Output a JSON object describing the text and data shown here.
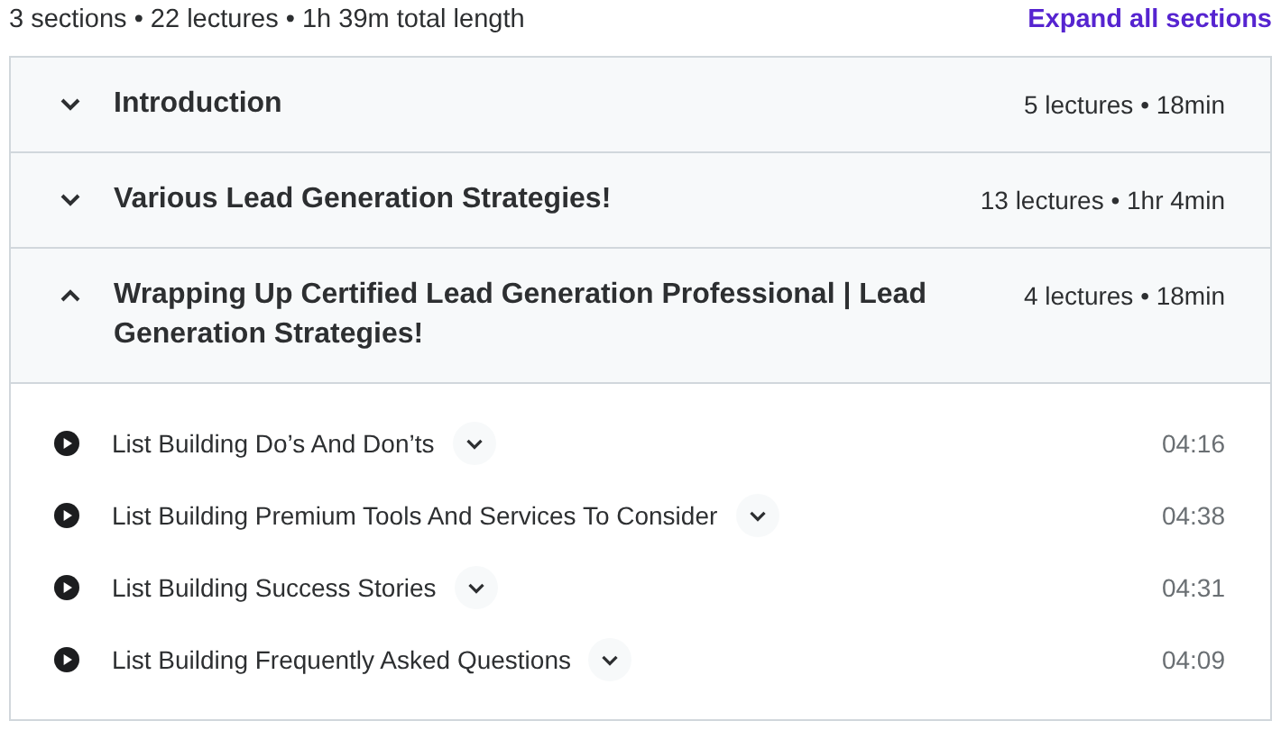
{
  "summary": "3 sections • 22 lectures • 1h 39m total length",
  "expand_all_link": "Expand all sections",
  "sections": [
    {
      "title": "Introduction",
      "meta": "5 lectures • 18min",
      "expanded": false
    },
    {
      "title": "Various Lead Generation Strategies!",
      "meta": "13 lectures • 1hr 4min",
      "expanded": false
    },
    {
      "title": "Wrapping Up Certified Lead Generation Professional | Lead Generation Strategies!",
      "meta": "4 lectures • 18min",
      "expanded": true,
      "lectures": [
        {
          "title": "List Building Do’s And Don’ts",
          "duration": "04:16"
        },
        {
          "title": "List Building Premium Tools And Services To Consider",
          "duration": "04:38"
        },
        {
          "title": "List Building Success Stories",
          "duration": "04:31"
        },
        {
          "title": "List Building Frequently Asked Questions",
          "duration": "04:09"
        }
      ]
    }
  ]
}
